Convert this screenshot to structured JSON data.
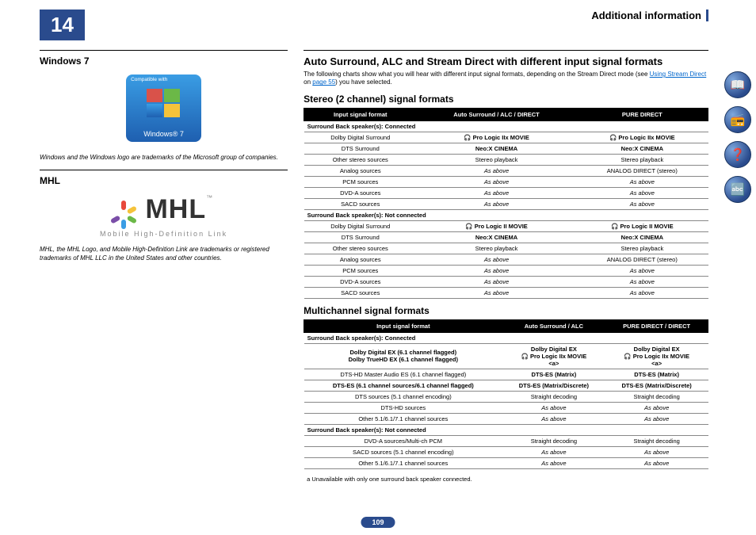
{
  "chapter": "14",
  "sectionTitle": "Additional information",
  "pageNumber": "109",
  "left": {
    "win7": {
      "heading": "Windows 7",
      "compatText": "Compatible with",
      "label": "Windows® 7",
      "trademark": "Windows and the Windows logo are trademarks of the Microsoft group of companies."
    },
    "mhl": {
      "heading": "MHL",
      "logoText": "MHL",
      "tagline": "Mobile High-Definition Link",
      "trademark": "MHL, the MHL Logo, and Mobile High-Definition Link are trademarks or registered trademarks of MHL LLC in the United States and other countries."
    }
  },
  "right": {
    "heading": "Auto Surround, ALC and Stream Direct with different input signal formats",
    "intro_a": "The following charts show what you will hear with different input signal formats, depending on the Stream Direct mode (see ",
    "intro_link": "Using Stream Direct",
    "intro_b": " on ",
    "intro_link2": "page 55",
    "intro_c": ") you have selected.",
    "table1": {
      "title": "Stereo (2 channel) signal formats",
      "headers": [
        "Input signal format",
        "Auto Surround / ALC / DIRECT",
        "PURE DIRECT"
      ],
      "sections": [
        {
          "groupHeader": "Surround Back speaker(s): Connected",
          "rows": [
            [
              "Dolby Digital Surround",
              "🎧 Pro Logic IIx MOVIE",
              "🎧 Pro Logic IIx MOVIE"
            ],
            [
              "DTS Surround",
              "Neo:X CINEMA",
              "Neo:X CINEMA"
            ],
            [
              "Other stereo sources",
              "Stereo playback",
              "Stereo playback"
            ],
            [
              "Analog sources",
              "As above",
              "ANALOG DIRECT (stereo)"
            ],
            [
              "PCM sources",
              "As above",
              "As above"
            ],
            [
              "DVD-A sources",
              "As above",
              "As above"
            ],
            [
              "SACD sources",
              "As above",
              "As above"
            ]
          ]
        },
        {
          "groupHeader": "Surround Back speaker(s): Not connected",
          "rows": [
            [
              "Dolby Digital Surround",
              "🎧 Pro Logic II MOVIE",
              "🎧 Pro Logic II MOVIE"
            ],
            [
              "DTS Surround",
              "Neo:X CINEMA",
              "Neo:X CINEMA"
            ],
            [
              "Other stereo sources",
              "Stereo playback",
              "Stereo playback"
            ],
            [
              "Analog sources",
              "As above",
              "ANALOG DIRECT (stereo)"
            ],
            [
              "PCM sources",
              "As above",
              "As above"
            ],
            [
              "DVD-A sources",
              "As above",
              "As above"
            ],
            [
              "SACD sources",
              "As above",
              "As above"
            ]
          ]
        }
      ]
    },
    "table2": {
      "title": "Multichannel signal formats",
      "headers": [
        "Input signal format",
        "Auto Surround / ALC",
        "PURE DIRECT / DIRECT"
      ],
      "sections": [
        {
          "groupHeader": "Surround Back speaker(s): Connected",
          "rows": [
            [
              "Dolby Digital EX (6.1 channel flagged)\nDolby TrueHD EX (6.1 channel flagged)",
              "Dolby Digital EX\n🎧 Pro Logic IIx MOVIE\n<a>",
              "Dolby Digital EX\n🎧 Pro Logic IIx MOVIE\n<a>"
            ],
            [
              "DTS-HD Master Audio ES (6.1 channel flagged)",
              "DTS-ES (Matrix)",
              "DTS-ES (Matrix)"
            ],
            [
              "DTS-ES (6.1 channel sources/6.1 channel flagged)",
              "DTS-ES (Matrix/Discrete)",
              "DTS-ES (Matrix/Discrete)"
            ],
            [
              "DTS sources (5.1 channel encoding)",
              "Straight decoding",
              "Straight decoding"
            ],
            [
              "DTS-HD sources",
              "As above",
              "As above"
            ],
            [
              "Other 5.1/6.1/7.1 channel sources",
              "As above",
              "As above"
            ]
          ]
        },
        {
          "groupHeader": "Surround Back speaker(s): Not connected",
          "rows": [
            [
              "DVD-A sources/Multi-ch PCM",
              "Straight decoding",
              "Straight decoding"
            ],
            [
              "SACD sources (5.1 channel encoding)",
              "As above",
              "As above"
            ],
            [
              "Other 5.1/6.1/7.1 channel sources",
              "As above",
              "As above"
            ]
          ]
        }
      ]
    },
    "footnote": "a  Unavailable with only one surround back speaker connected."
  },
  "nav": {
    "book": "📖",
    "device": "📻",
    "help": "❓",
    "glossary": "🔤"
  }
}
